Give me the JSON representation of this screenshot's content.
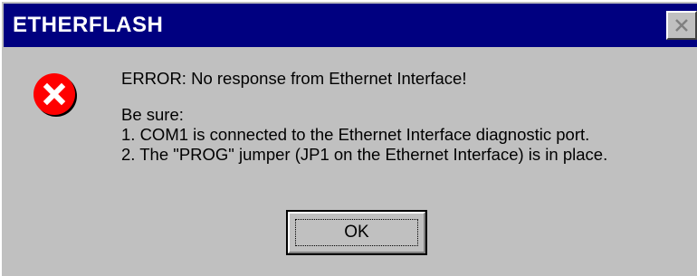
{
  "window": {
    "title": "ETHERFLASH",
    "close_glyph": "×"
  },
  "icon": {
    "name": "error-icon",
    "color": "#e00000"
  },
  "message": {
    "headline": "ERROR: No response from Ethernet Interface!",
    "intro": "Be sure:",
    "items": [
      "1. COM1 is connected to the Ethernet Interface diagnostic port.",
      "2. The \"PROG\" jumper (JP1 on the Ethernet Interface) is in place."
    ]
  },
  "buttons": {
    "ok_label": "OK"
  }
}
